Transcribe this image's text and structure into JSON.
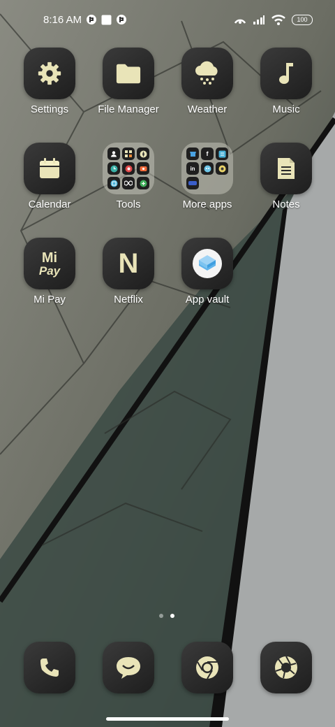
{
  "status_bar": {
    "time": "8:16 AM",
    "battery": "100",
    "left_icons": [
      "vpn-key-icon",
      "square-notification-icon",
      "vpn-key-icon"
    ],
    "right_icons": [
      "hotspot-icon",
      "signal-icon",
      "wifi-icon"
    ]
  },
  "apps": {
    "settings": "Settings",
    "file_manager": "File Manager",
    "weather": "Weather",
    "music": "Music",
    "calendar": "Calendar",
    "tools": "Tools",
    "more_apps": "More apps",
    "notes": "Notes",
    "mi_pay": "Mi Pay",
    "netflix": "Netflix",
    "app_vault": "App vault"
  },
  "icon_text": {
    "mi_pay_top": "Mi",
    "mi_pay_bottom": "Pay",
    "netflix": "N"
  },
  "folders": {
    "tools_items": [
      "contacts-icon",
      "calculator-icon",
      "compass-icon",
      "clock-icon",
      "recorder-icon",
      "screen-recorder-icon",
      "scanner-icon",
      "infinity-icon",
      "cleaner-icon"
    ],
    "more_apps_items": [
      "store-icon",
      "facebook-icon",
      "app-icon",
      "linkedin-icon",
      "game-icon",
      "app-icon",
      "app-icon"
    ]
  },
  "page_indicator": {
    "count": 2,
    "active_index": 1
  },
  "dock": [
    "phone-icon",
    "messages-icon",
    "chrome-icon",
    "camera-icon"
  ],
  "colors": {
    "icon_tint": "#e9e4b8",
    "icon_bg": "#2a2a2a"
  }
}
